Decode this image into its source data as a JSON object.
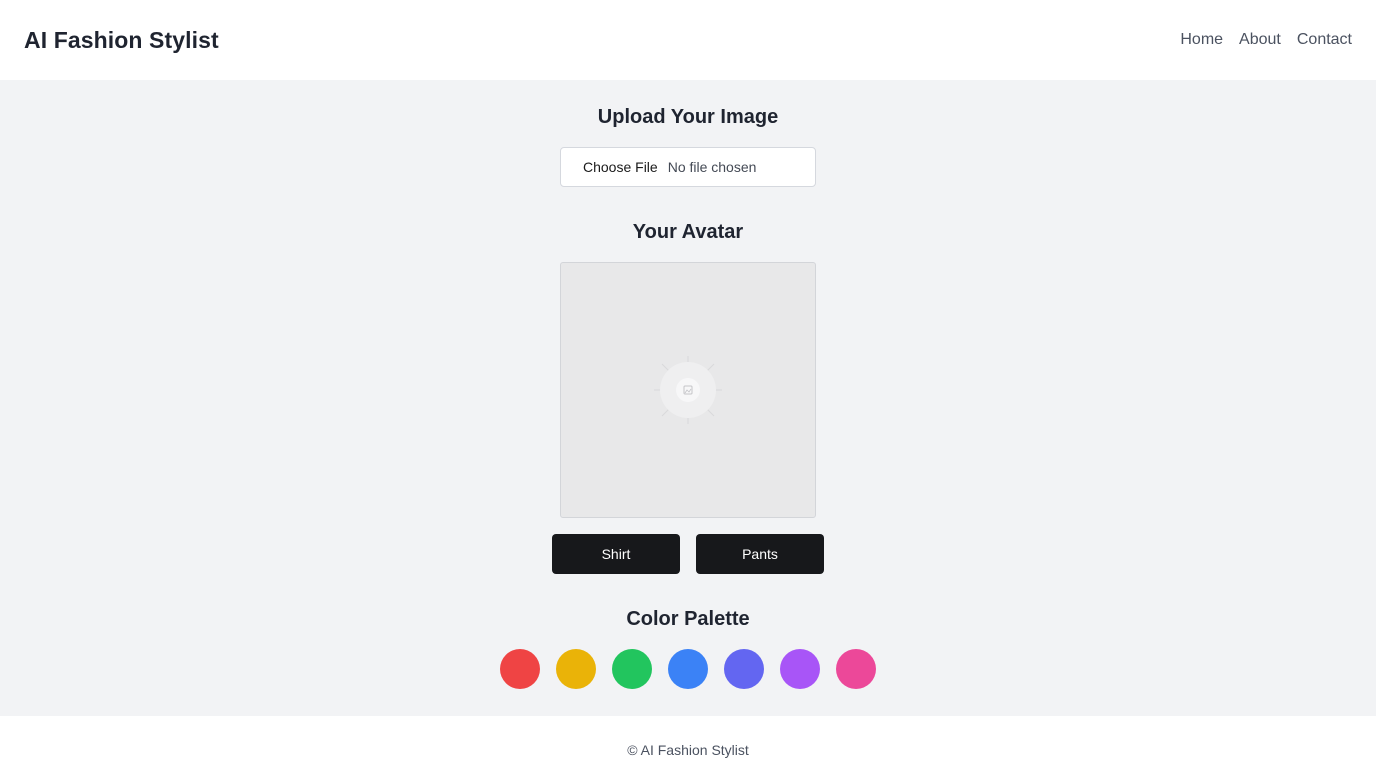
{
  "header": {
    "brand": "AI Fashion Stylist",
    "nav": [
      {
        "label": "Home"
      },
      {
        "label": "About"
      },
      {
        "label": "Contact"
      }
    ]
  },
  "upload": {
    "title": "Upload Your Image",
    "button_label": "Choose File",
    "status": "No file chosen"
  },
  "avatar": {
    "title": "Your Avatar",
    "placeholder_icon": "image-placeholder-icon"
  },
  "clothing": {
    "buttons": [
      {
        "label": "Shirt"
      },
      {
        "label": "Pants"
      }
    ]
  },
  "palette": {
    "title": "Color Palette",
    "colors": [
      "#ef4444",
      "#eab308",
      "#22c55e",
      "#3b82f6",
      "#6366f1",
      "#a855f7",
      "#ec4899"
    ]
  },
  "footer": {
    "text": "© AI Fashion Stylist"
  }
}
